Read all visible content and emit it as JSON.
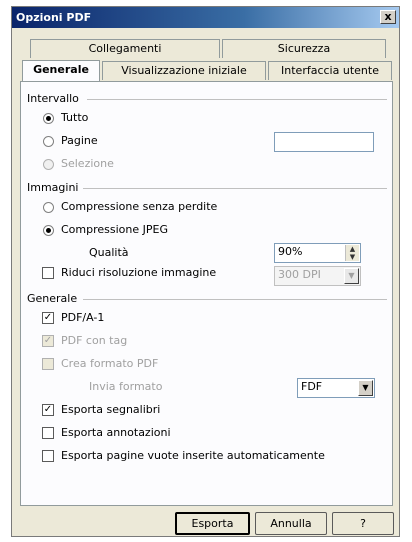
{
  "window": {
    "title": "Opzioni PDF",
    "close_glyph": "x"
  },
  "tabs": {
    "row1": [
      "Collegamenti",
      "Sicurezza"
    ],
    "row2": [
      "Generale",
      "Visualizzazione iniziale",
      "Interfaccia utente"
    ],
    "active": "Generale"
  },
  "intervallo": {
    "label": "Intervallo",
    "tutto": "Tutto",
    "pagine": "Pagine",
    "pagine_value": "",
    "selezione": "Selezione",
    "selected": "Tutto"
  },
  "immagini": {
    "label": "Immagini",
    "lossless": "Compressione senza perdite",
    "jpeg": "Compressione JPEG",
    "selected": "Compressione JPEG",
    "quality_label": "Qualità",
    "quality_value": "90%",
    "reduce_label": "Riduci risoluzione immagine",
    "reduce_checked": false,
    "dpi_value": "300 DPI"
  },
  "generale": {
    "label": "Generale",
    "pdfa": "PDF/A-1",
    "pdfa_checked": true,
    "tagged": "PDF con tag",
    "tagged_checked": true,
    "create_form": "Crea formato PDF",
    "create_form_checked": false,
    "submit_label": "Invia formato",
    "submit_value": "FDF",
    "bookmarks": "Esporta segnalibri",
    "bookmarks_checked": true,
    "notes": "Esporta annotazioni",
    "notes_checked": false,
    "empty_pages": "Esporta pagine vuote inserite automaticamente",
    "empty_pages_checked": false
  },
  "buttons": {
    "export": "Esporta",
    "cancel": "Annulla",
    "help": "?"
  }
}
